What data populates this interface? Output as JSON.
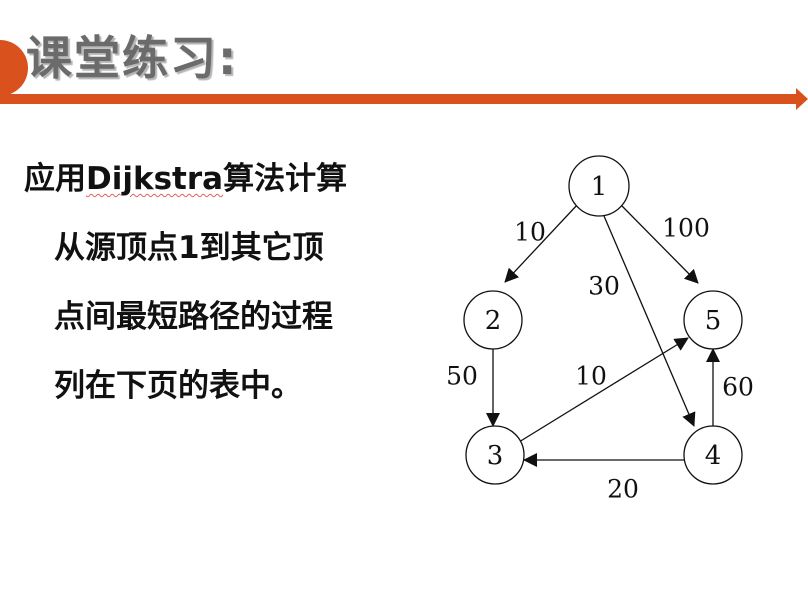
{
  "title": "课堂练习:",
  "body_text": {
    "line1_prefix": "应用",
    "line1_highlight": "Dijkstra",
    "line1_suffix": "算法计算",
    "line2": "从源顶点1到其它顶",
    "line3": "点间最短路径的过程",
    "line4": "列在下页的表中。"
  },
  "colors": {
    "accent": "#d9521e",
    "title": "#6b6b6b",
    "text": "#111111"
  },
  "graph": {
    "nodes": [
      {
        "id": "n1",
        "label": "1"
      },
      {
        "id": "n2",
        "label": "2"
      },
      {
        "id": "n3",
        "label": "3"
      },
      {
        "id": "n4",
        "label": "4"
      },
      {
        "id": "n5",
        "label": "5"
      }
    ],
    "edges": [
      {
        "from": "1",
        "to": "2",
        "weight": "10"
      },
      {
        "from": "1",
        "to": "5",
        "weight": "100"
      },
      {
        "from": "1",
        "to": "4",
        "weight": "30"
      },
      {
        "from": "2",
        "to": "3",
        "weight": "50"
      },
      {
        "from": "3",
        "to": "5",
        "weight": "10"
      },
      {
        "from": "4",
        "to": "5",
        "weight": "60"
      },
      {
        "from": "4",
        "to": "3",
        "weight": "20"
      }
    ]
  }
}
